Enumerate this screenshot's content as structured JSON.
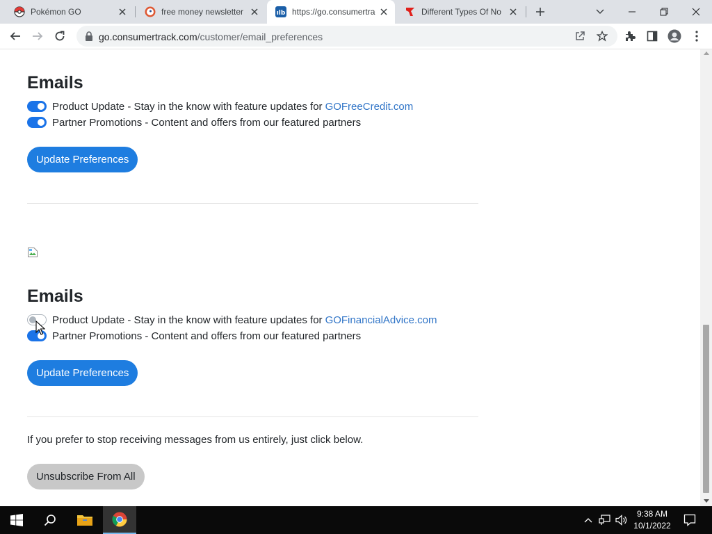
{
  "browser": {
    "tabs": [
      {
        "title": "Pokémon GO",
        "favicon": "pokeball-icon"
      },
      {
        "title": "free money newsletter",
        "favicon": "duckduckgo-icon"
      },
      {
        "title": "https://go.consumertrack.com",
        "favicon": "consumertrack-icon"
      },
      {
        "title": "Different Types Of No",
        "favicon": "red-flag-icon"
      }
    ],
    "active_tab_index": 2,
    "url_domain": "go.consumertrack.com",
    "url_path": "/customer/email_preferences"
  },
  "page": {
    "section1": {
      "heading": "Emails",
      "prefs": [
        {
          "label": "Product Update - Stay in the know with feature updates for",
          "link": "GOFreeCredit.com",
          "enabled": true
        },
        {
          "label": "Partner Promotions - Content and offers from our featured partners",
          "link": "",
          "enabled": true
        }
      ],
      "button": "Update Preferences"
    },
    "section2": {
      "heading": "Emails",
      "prefs": [
        {
          "label": "Product Update - Stay in the know with feature updates for",
          "link": "GOFinancialAdvice.com",
          "enabled": false
        },
        {
          "label": "Partner Promotions - Content and offers from our featured partners",
          "link": "",
          "enabled": true
        }
      ],
      "button": "Update Preferences"
    },
    "unsubscribe_text": "If you prefer to stop receiving messages from us entirely, just click below.",
    "unsubscribe_button": "Unsubscribe From All"
  },
  "taskbar": {
    "time": "9:38 AM",
    "date": "10/1/2022"
  },
  "colors": {
    "accent": "#1e7de0",
    "link": "#2f74c7",
    "toggle_on": "#1a73e8"
  }
}
